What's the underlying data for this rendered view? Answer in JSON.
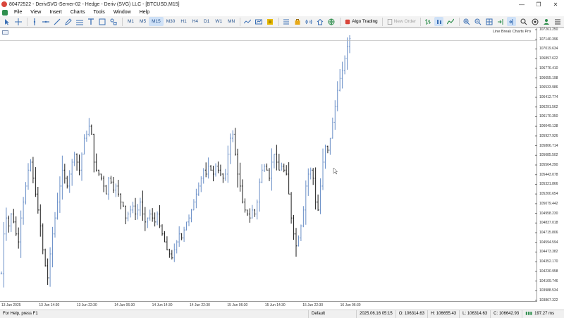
{
  "window": {
    "title": "80472522 - DerivSVG-Server-02 - Hedge - Deriv (SVG) LLC - [BTCUSD,M15]",
    "minimize": "—",
    "maximize": "❐",
    "close": "✕"
  },
  "menu": {
    "items": [
      "File",
      "View",
      "Insert",
      "Charts",
      "Tools",
      "Window",
      "Help"
    ]
  },
  "toolbar": {
    "timeframes": [
      "M1",
      "M5",
      "M15",
      "M30",
      "H1",
      "H4",
      "D1",
      "W1",
      "MN"
    ],
    "active_timeframe": "M15",
    "algo_trading": "Algo Trading",
    "new_order": "New Order",
    "accent": "#1f4e8c"
  },
  "chart": {
    "symbol": "BTCUSD",
    "timeframe": "M15",
    "label": "Line Break Charts Pro",
    "bar_color": "#1a1a1a",
    "bull_color": "#6a8fc7"
  },
  "chart_data": {
    "type": "line",
    "y_ticks": [
      "107261.250",
      "107140.396",
      "107019.634",
      "106897.622",
      "106776.410",
      "106655.198",
      "106533.986",
      "106412.774",
      "106291.562",
      "106170.350",
      "106049.138",
      "105927.926",
      "105806.714",
      "105685.502",
      "105564.290",
      "105443.078",
      "105321.866",
      "105200.654",
      "105079.442",
      "104958.230",
      "104837.018",
      "104715.806",
      "104594.594",
      "104473.382",
      "104352.170",
      "104230.958",
      "104109.746",
      "103988.534",
      "103867.322"
    ],
    "x_ticks": [
      "13 Jun 2025",
      "13 Jun 14:30",
      "13 Jun 22:30",
      "14 Jun 06:30",
      "14 Jun 14:30",
      "14 Jun 22:30",
      "15 Jun 06:30",
      "15 Jun 14:30",
      "15 Jun 22:30",
      "16 Jun 06:30"
    ],
    "ylim": [
      103867.322,
      107261.25
    ],
    "grid": false,
    "series": [
      {
        "values": [
          104200,
          104700,
          104900,
          104800,
          104950,
          104850,
          104700,
          104600,
          104900,
          105100,
          105300,
          105500,
          105600,
          105400,
          105200,
          105000,
          104800,
          104500,
          104300,
          104150,
          104450,
          104700,
          104900,
          105100,
          105300,
          105500,
          105400,
          105300,
          105450,
          105600,
          105700,
          105600,
          105500,
          105700,
          105900,
          105950,
          106050,
          105950,
          105600,
          105500,
          105450,
          105400,
          105300,
          105200,
          105400,
          105350,
          105250,
          105300,
          105200,
          105100,
          105050,
          104900,
          104950,
          105000,
          105050,
          104950,
          105000,
          105100,
          104950,
          104850,
          104900,
          104950,
          104900,
          104850,
          104950,
          104800,
          104700,
          104600,
          104500,
          104450,
          104400,
          104500,
          104600,
          104700,
          104650,
          104750,
          104850,
          104900,
          105000,
          105100,
          105200,
          105300,
          105400,
          105500,
          105450,
          105550,
          105500,
          105450,
          105550,
          105500,
          105450,
          105400,
          105450,
          105700,
          105900,
          105950,
          105700,
          105450,
          105300,
          105100,
          105000,
          104950,
          104900,
          105000,
          104950,
          105100,
          105350,
          105500,
          105550,
          105500,
          105400,
          105600,
          105700,
          105600,
          105500,
          105550,
          105500,
          105450,
          105200,
          104900,
          104700,
          104550,
          104650,
          104800,
          105000,
          105300,
          105450,
          105500,
          105400,
          105100,
          105000,
          105300,
          105600,
          105800,
          105750,
          105900,
          106100,
          106300,
          106500,
          106650,
          106750,
          106900,
          107050,
          107150
        ]
      }
    ]
  },
  "status": {
    "help": "For Help, press F1",
    "profile": "Default",
    "datetime": "2025.06.16 05:15",
    "open": "O: 106314.63",
    "high": "H: 106655.43",
    "low": "L: 106314.63",
    "close": "C: 106642.93",
    "traffic": "197.27 ms"
  }
}
